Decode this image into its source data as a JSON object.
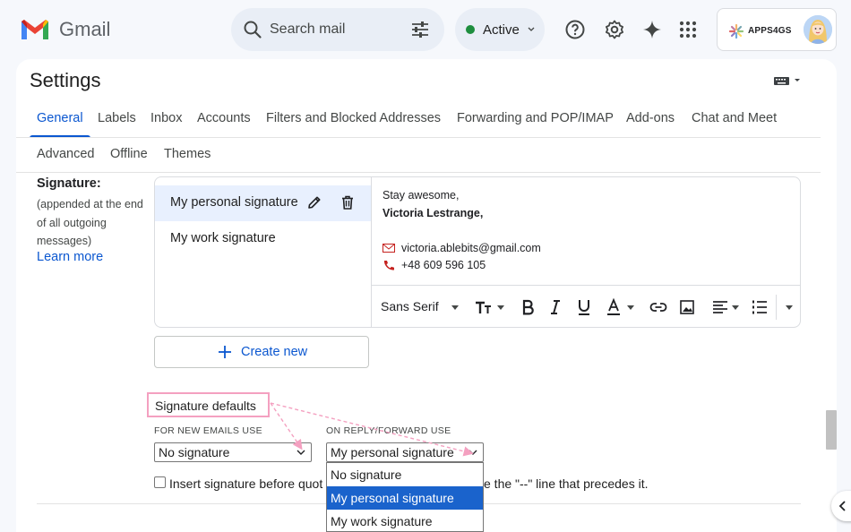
{
  "header": {
    "app_name": "Gmail",
    "search_placeholder": "Search mail",
    "status_label": "Active",
    "account_brand": "APPS4GS"
  },
  "settings": {
    "title": "Settings",
    "tabs_row1": [
      "General",
      "Labels",
      "Inbox",
      "Accounts",
      "Filters and Blocked Addresses",
      "Forwarding and POP/IMAP",
      "Add-ons",
      "Chat and Meet"
    ],
    "tabs_row2": [
      "Advanced",
      "Offline",
      "Themes"
    ],
    "active_tab": "General"
  },
  "signature": {
    "label": "Signature:",
    "note": "(appended at the end of all outgoing messages)",
    "learn_more": "Learn more",
    "items": [
      {
        "name": "My personal signature",
        "selected": true
      },
      {
        "name": "My work signature",
        "selected": false
      }
    ],
    "editor": {
      "line1": "Stay awesome,",
      "line2": "Victoria Lestrange,",
      "email": "victoria.ablebits@gmail.com",
      "phone": "+48 609 596 105"
    },
    "toolbar": {
      "font": "Sans Serif"
    },
    "create_new": "Create new"
  },
  "defaults": {
    "title": "Signature defaults",
    "new_emails_caption": "FOR NEW EMAILS USE",
    "new_emails_value": "No signature",
    "reply_caption": "ON REPLY/FORWARD USE",
    "reply_value": "My personal signature",
    "options": [
      "No signature",
      "My personal signature",
      "My work signature"
    ],
    "highlighted_option": "My personal signature",
    "insert_text_a": "Insert signature before quot",
    "insert_text_b": "e the \"--\" line that precedes it."
  },
  "colors": {
    "accent": "#0b57d0",
    "annotation": "#f4a0c0",
    "highlight": "#1a63cc",
    "status_green": "#1e8e3e"
  }
}
